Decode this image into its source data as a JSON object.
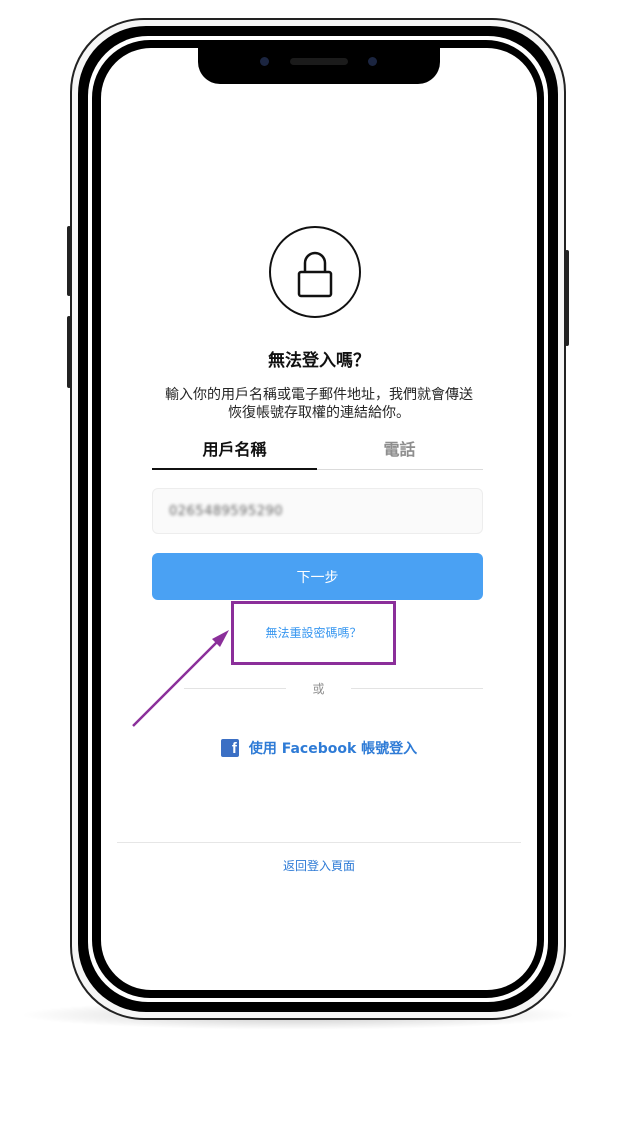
{
  "screen": {
    "title": "無法登入嗎？",
    "description": "輸入你的用戶名稱或電子郵件地址，我們就會傳送恢復帳號存取權的連結給你。",
    "tabs": [
      {
        "label": "用戶名稱",
        "active": true
      },
      {
        "label": "電話",
        "active": false
      }
    ],
    "username_input": {
      "value": "0265489595290"
    },
    "next_button": {
      "label": "下一步"
    },
    "reset_link": {
      "label": "無法重設密碼嗎？"
    },
    "divider": {
      "label": "或"
    },
    "facebook_login": {
      "label": "使用 Facebook 帳號登入"
    },
    "back_link": {
      "label": "返回登入頁面"
    }
  },
  "colors": {
    "primary_button": "#4aa1f3",
    "link": "#3897f0",
    "facebook": "#3b6fc4",
    "highlight_box": "#8b2f9a",
    "annotation_arrow": "#8b2f9a"
  },
  "icons": {
    "lock": "lock-icon",
    "facebook": "facebook-icon"
  }
}
